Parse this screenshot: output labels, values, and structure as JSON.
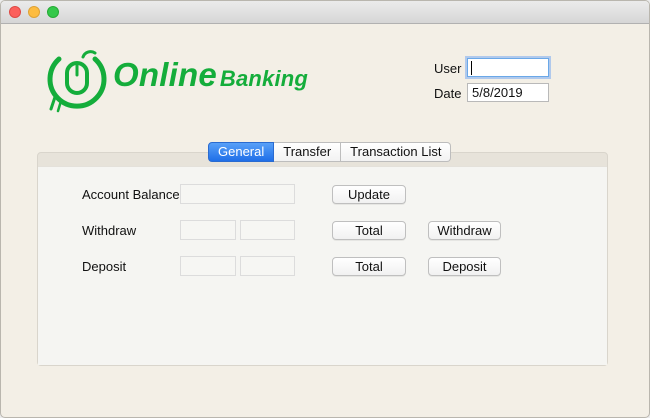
{
  "window": {
    "traffic_lights": [
      "close",
      "minimize",
      "zoom"
    ]
  },
  "logo": {
    "online": "Online",
    "banking": "Banking",
    "icon": "mouse-circle-icon",
    "color": "#14ad3b"
  },
  "header": {
    "user_label": "User",
    "user_value": "",
    "date_label": "Date",
    "date_value": "5/8/2019"
  },
  "tabs": [
    {
      "label": "General",
      "active": true
    },
    {
      "label": "Transfer",
      "active": false
    },
    {
      "label": "Transaction List",
      "active": false
    }
  ],
  "general": {
    "account_balance_label": "Account Balance",
    "account_balance_value": "",
    "update_button": "Update",
    "withdraw_label": "Withdraw",
    "withdraw_total_button": "Total",
    "withdraw_button": "Withdraw",
    "deposit_label": "Deposit",
    "deposit_total_button": "Total",
    "deposit_button": "Deposit"
  },
  "colors": {
    "accent": "#1f6fe8",
    "brand": "#14ad3b",
    "background": "#f3efe6"
  }
}
